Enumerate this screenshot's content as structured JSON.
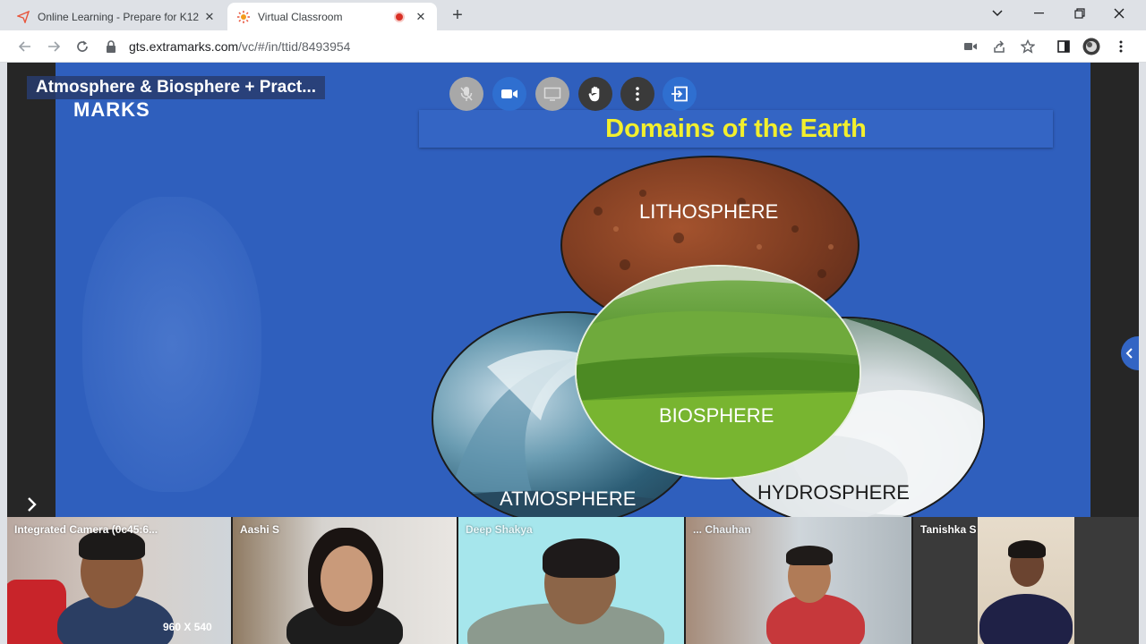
{
  "browser": {
    "tabs": [
      {
        "title": "Online Learning - Prepare for K12",
        "icon": "paper-plane-icon",
        "active": false
      },
      {
        "title": "Virtual Classroom",
        "icon": "sun-logo-icon",
        "active": true
      }
    ],
    "url_host": "gts.extramarks.com",
    "url_path": "/vc/#/in/ttid/8493954"
  },
  "classroom": {
    "title": "Atmosphere & Biosphere + Pract...",
    "controls": [
      "mic-off-icon",
      "camera-icon",
      "screen-share-icon",
      "raise-hand-icon",
      "more-options-icon",
      "exit-icon"
    ]
  },
  "slide": {
    "logo_text": "MARKS",
    "title": "Domains of the Earth",
    "spheres": {
      "litho": "LITHOSPHERE",
      "bio": "BIOSPHERE",
      "atmo": "ATMOSPHERE",
      "hydro": "HYDROSPHERE"
    }
  },
  "participants": [
    {
      "name": "Integrated Camera (0c45:6...",
      "resolution": "960 X 540"
    },
    {
      "name": "Aashi S"
    },
    {
      "name": "Deep Shakya"
    },
    {
      "name": "... Chauhan"
    },
    {
      "name": "Tanishka S"
    }
  ],
  "colors": {
    "slide_bg": "#2f5fbd",
    "title_yellow": "#f2ef2d",
    "accent_blue": "#2f6fd0",
    "record_red": "#d93025"
  }
}
